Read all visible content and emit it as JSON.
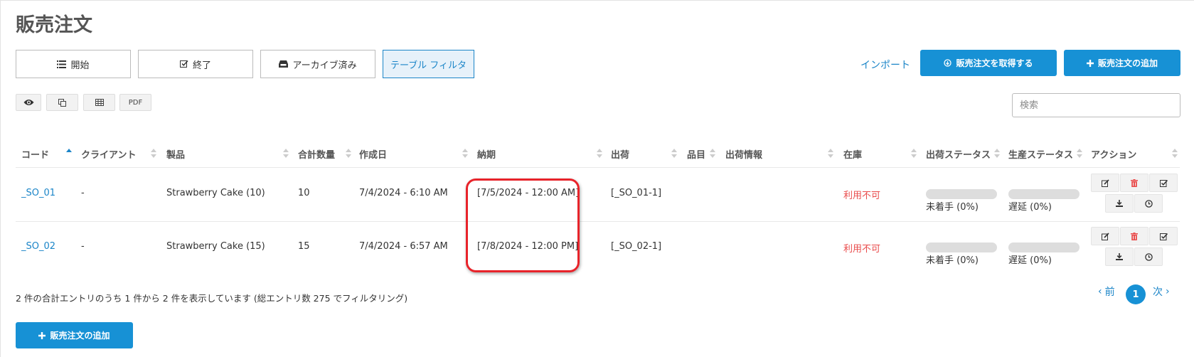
{
  "page": {
    "title": "販売注文"
  },
  "tabs": [
    {
      "label": "開始",
      "icon": "list-icon"
    },
    {
      "label": "終了",
      "icon": "check-square-icon"
    },
    {
      "label": "アーカイブ済み",
      "icon": "inbox-icon"
    },
    {
      "label": "テーブル フィルタ",
      "active": true
    }
  ],
  "header_actions": {
    "import_label": "インポート",
    "fetch_label": "販売注文を取得する",
    "add_label": "販売注文の追加"
  },
  "tools": [
    {
      "name": "eye-icon"
    },
    {
      "name": "copy-icon"
    },
    {
      "name": "table-icon"
    },
    {
      "label": "PDF"
    }
  ],
  "search": {
    "placeholder": "検索",
    "value": ""
  },
  "table": {
    "columns": [
      "コード",
      "クライアント",
      "製品",
      "合計数量",
      "作成日",
      "納期",
      "出荷",
      "品目",
      "出荷情報",
      "在庫",
      "出荷ステータス",
      "生産ステータス",
      "アクション"
    ],
    "sorted_column": "コード",
    "rows": [
      {
        "code": "_SO_01",
        "client": "-",
        "product": "Strawberry Cake (10)",
        "qty": "10",
        "created": "7/4/2024 - 6:10 AM",
        "delivery": "[7/5/2024 - 12:00 AM]",
        "shipment": "[_SO_01-1]",
        "items": "",
        "ship_info": "",
        "stock": "利用不可",
        "ship_status": "未着手 (0%)",
        "ship_progress": 0,
        "prod_status": "遅延 (0%)",
        "prod_progress": 0
      },
      {
        "code": "_SO_02",
        "client": "-",
        "product": "Strawberry Cake (15)",
        "qty": "15",
        "created": "7/4/2024 - 6:57 AM",
        "delivery": "[7/8/2024 - 12:00 PM]",
        "shipment": "[_SO_02-1]",
        "items": "",
        "ship_info": "",
        "stock": "利用不可",
        "ship_status": "未着手 (0%)",
        "ship_progress": 0,
        "prod_status": "遅延 (0%)",
        "prod_progress": 0
      }
    ]
  },
  "footer": {
    "info": "2 件の合計エントリのうち 1 件から 2 件を表示しています (総エントリ数 275 でフィルタリング)",
    "prev_label": "前",
    "current_page": "1",
    "next_label": "次",
    "add_label": "販売注文の追加"
  },
  "colors": {
    "accent": "#1791d5",
    "link": "#1b85c8",
    "danger": "#e94b4b",
    "highlight": "#e8232a"
  }
}
